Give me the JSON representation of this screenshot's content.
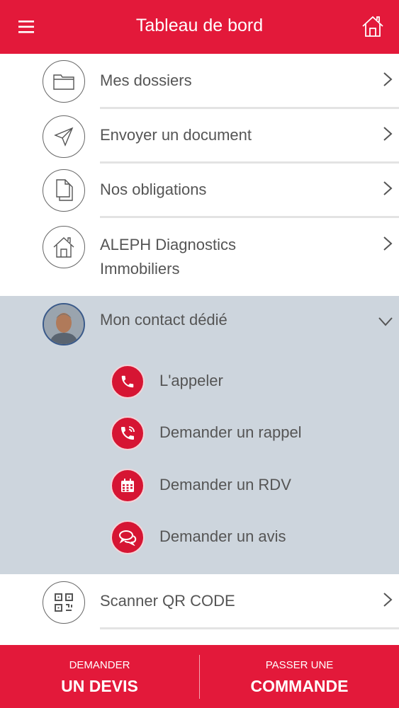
{
  "header": {
    "title": "Tableau de bord",
    "menu_icon": "hamburger-icon",
    "home_icon": "home-icon"
  },
  "menu": [
    {
      "label": "Mes dossiers",
      "icon": "folder-icon"
    },
    {
      "label": "Envoyer un document",
      "icon": "send-icon"
    },
    {
      "label": "Nos obligations",
      "icon": "documents-icon"
    },
    {
      "label_line1": "ALEPH Diagnostics",
      "label_line2": "Immobiliers",
      "icon": "house-icon"
    }
  ],
  "contact": {
    "label": "Mon contact dédié",
    "actions": [
      {
        "label": "L'appeler",
        "icon": "phone-icon"
      },
      {
        "label": "Demander un rappel",
        "icon": "callback-icon"
      },
      {
        "label": "Demander un RDV",
        "icon": "calendar-icon"
      },
      {
        "label": "Demander un avis",
        "icon": "chat-icon"
      }
    ]
  },
  "scanner": {
    "label": "Scanner QR CODE",
    "icon": "qr-code-icon"
  },
  "bottom": {
    "left": {
      "small": "DEMANDER",
      "big": "UN DEVIS"
    },
    "right": {
      "small": "PASSER UNE",
      "big": "COMMANDE"
    }
  },
  "colors": {
    "brand_red": "#e3193a",
    "panel_gray": "#cdd5dd"
  }
}
